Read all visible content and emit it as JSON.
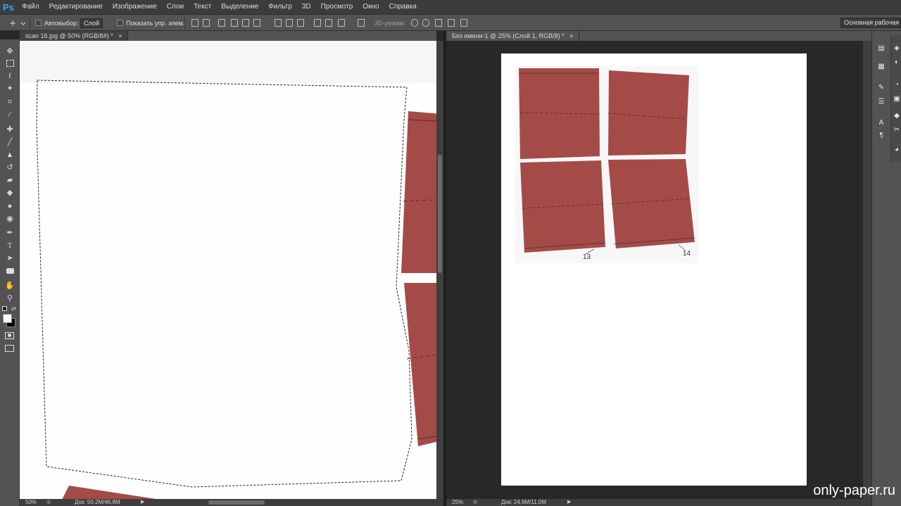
{
  "app": {
    "logo": "Ps"
  },
  "menu": [
    "Файл",
    "Редактирование",
    "Изображение",
    "Слои",
    "Текст",
    "Выделение",
    "Фильтр",
    "3D",
    "Просмотр",
    "Окно",
    "Справка"
  ],
  "options": {
    "autoselect_label": "Автовыбор:",
    "autoselect_value": "Слой",
    "show_controls_label": "Показать упр. элем.",
    "mode_3d_label": "3D-режим:",
    "workspace": "Основная рабочая среда"
  },
  "doc1": {
    "tab_title": "scan 16.jpg @ 50% (RGB/8#) *",
    "close_glyph": "×",
    "zoom": "50%",
    "doc_size": "Док: 50,2M/46,8M"
  },
  "doc2": {
    "tab_title": "Без имени-1 @ 25% (Слой 1, RGB/8) *",
    "close_glyph": "×",
    "zoom": "25%",
    "doc_size": "Док: 24,9M/11,0M",
    "part_labels": [
      "13",
      "14"
    ]
  },
  "watermark": "only-paper.ru",
  "colors": {
    "part_fill": "#a44b48",
    "accent": "#3fa0ff"
  },
  "tools": [
    "move-tool-icon",
    "marquee-tool-icon",
    "lasso-tool-icon",
    "magic-wand-icon",
    "crop-tool-icon",
    "eyedropper-icon",
    "healing-brush-icon",
    "brush-icon",
    "clone-stamp-icon",
    "history-brush-icon",
    "eraser-icon",
    "paint-bucket-icon",
    "blur-tool-icon",
    "dodge-tool-icon",
    "pen-tool-icon",
    "type-tool-icon",
    "path-selection-icon",
    "shape-tool-icon",
    "hand-tool-icon",
    "zoom-tool-icon"
  ]
}
